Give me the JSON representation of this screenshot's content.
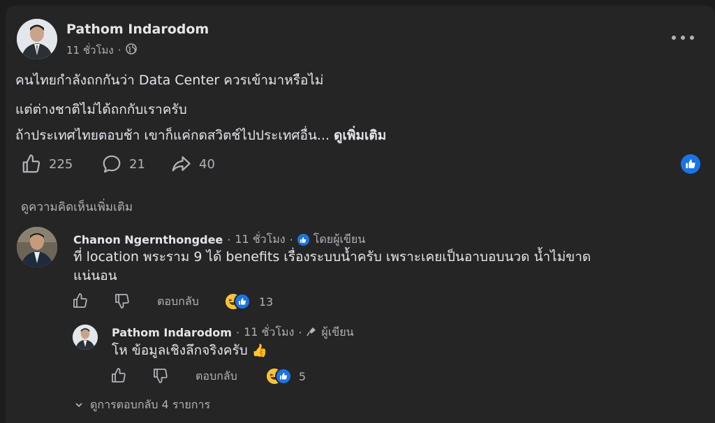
{
  "post": {
    "author": "Pathom Indarodom",
    "time": "11 ชั่วโมง",
    "separator": "·",
    "privacy_icon": "globe-icon",
    "lines": [
      "คนไทยกำลังถกกันว่า Data Center ควรเข้ามาหรือไม่",
      "แต่ต่างชาติไม่ได้ถกกับเราครับ",
      "ถ้าประเทศไทยตอบช้า เขาก็แค่กดสวิตช์ไปประเทศอื่น..."
    ],
    "see_more": "ดูเพิ่มเติม",
    "likes": "225",
    "comments": "21",
    "shares": "40"
  },
  "more_comments_label": "ดูความคิดเห็นเพิ่มเติม",
  "comment": {
    "author": "Chanon Ngernthongdee",
    "time": "11 ชั่วโมง",
    "badge": "โดยผู้เขียน",
    "text_line1": "ที่ location พระราม 9 ได้ benefits เรื่องระบบน้ำครับ เพราะเคยเป็นอาบอบนวด น้ำไม่ขาด",
    "text_line2": "แน่นอน",
    "reply_label": "ตอบกลับ",
    "reaction_count": "13"
  },
  "reply": {
    "author": "Pathom Indarodom",
    "time": "11 ชั่วโมง",
    "badge": "ผู้เขียน",
    "text": "โห ข้อมูลเชิงลึกจริงครับ",
    "emoji": "👍",
    "reply_label": "ตอบกลับ",
    "reaction_count": "5"
  },
  "view_replies_label": "ดูการตอบกลับ 4 รายการ",
  "colors": {
    "background": "#1c1c1d",
    "card": "#252526",
    "text": "#e4e6eb",
    "muted": "#b0b3b8",
    "accent": "#1b74e4"
  }
}
